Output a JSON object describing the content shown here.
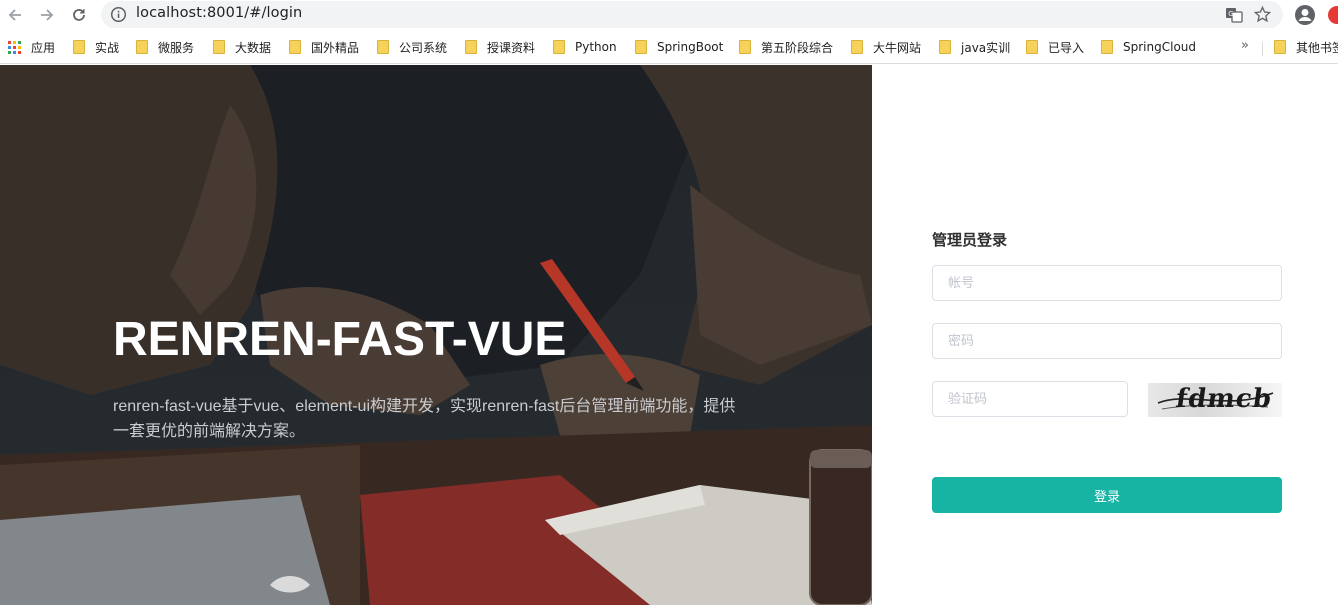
{
  "browser": {
    "url": "localhost:8001/#/login",
    "bookmarks": [
      {
        "label": "应用",
        "kind": "apps"
      },
      {
        "label": "实战",
        "kind": "folder"
      },
      {
        "label": "微服务",
        "kind": "folder"
      },
      {
        "label": "大数据",
        "kind": "folder"
      },
      {
        "label": "国外精品",
        "kind": "folder"
      },
      {
        "label": "公司系统",
        "kind": "folder"
      },
      {
        "label": "授课资料",
        "kind": "folder"
      },
      {
        "label": "Python",
        "kind": "folder"
      },
      {
        "label": "SpringBoot",
        "kind": "folder"
      },
      {
        "label": "第五阶段综合",
        "kind": "folder"
      },
      {
        "label": "大牛网站",
        "kind": "folder"
      },
      {
        "label": "java实训",
        "kind": "folder"
      },
      {
        "label": "已导入",
        "kind": "folder"
      },
      {
        "label": "SpringCloud",
        "kind": "folder"
      }
    ],
    "more_label": "»",
    "other_bookmarks_label": "其他书签"
  },
  "brand": {
    "title": "RENREN-FAST-VUE",
    "description": "renren-fast-vue基于vue、element-ui构建开发，实现renren-fast后台管理前端功能，提供一套更优的前端解决方案。"
  },
  "login": {
    "title": "管理员登录",
    "username_placeholder": "帐号",
    "password_placeholder": "密码",
    "captcha_placeholder": "验证码",
    "captcha_text": "fdmcb",
    "submit_label": "登录"
  },
  "colors": {
    "primary": "#17b3a3",
    "hero_dark": "#22272b"
  }
}
